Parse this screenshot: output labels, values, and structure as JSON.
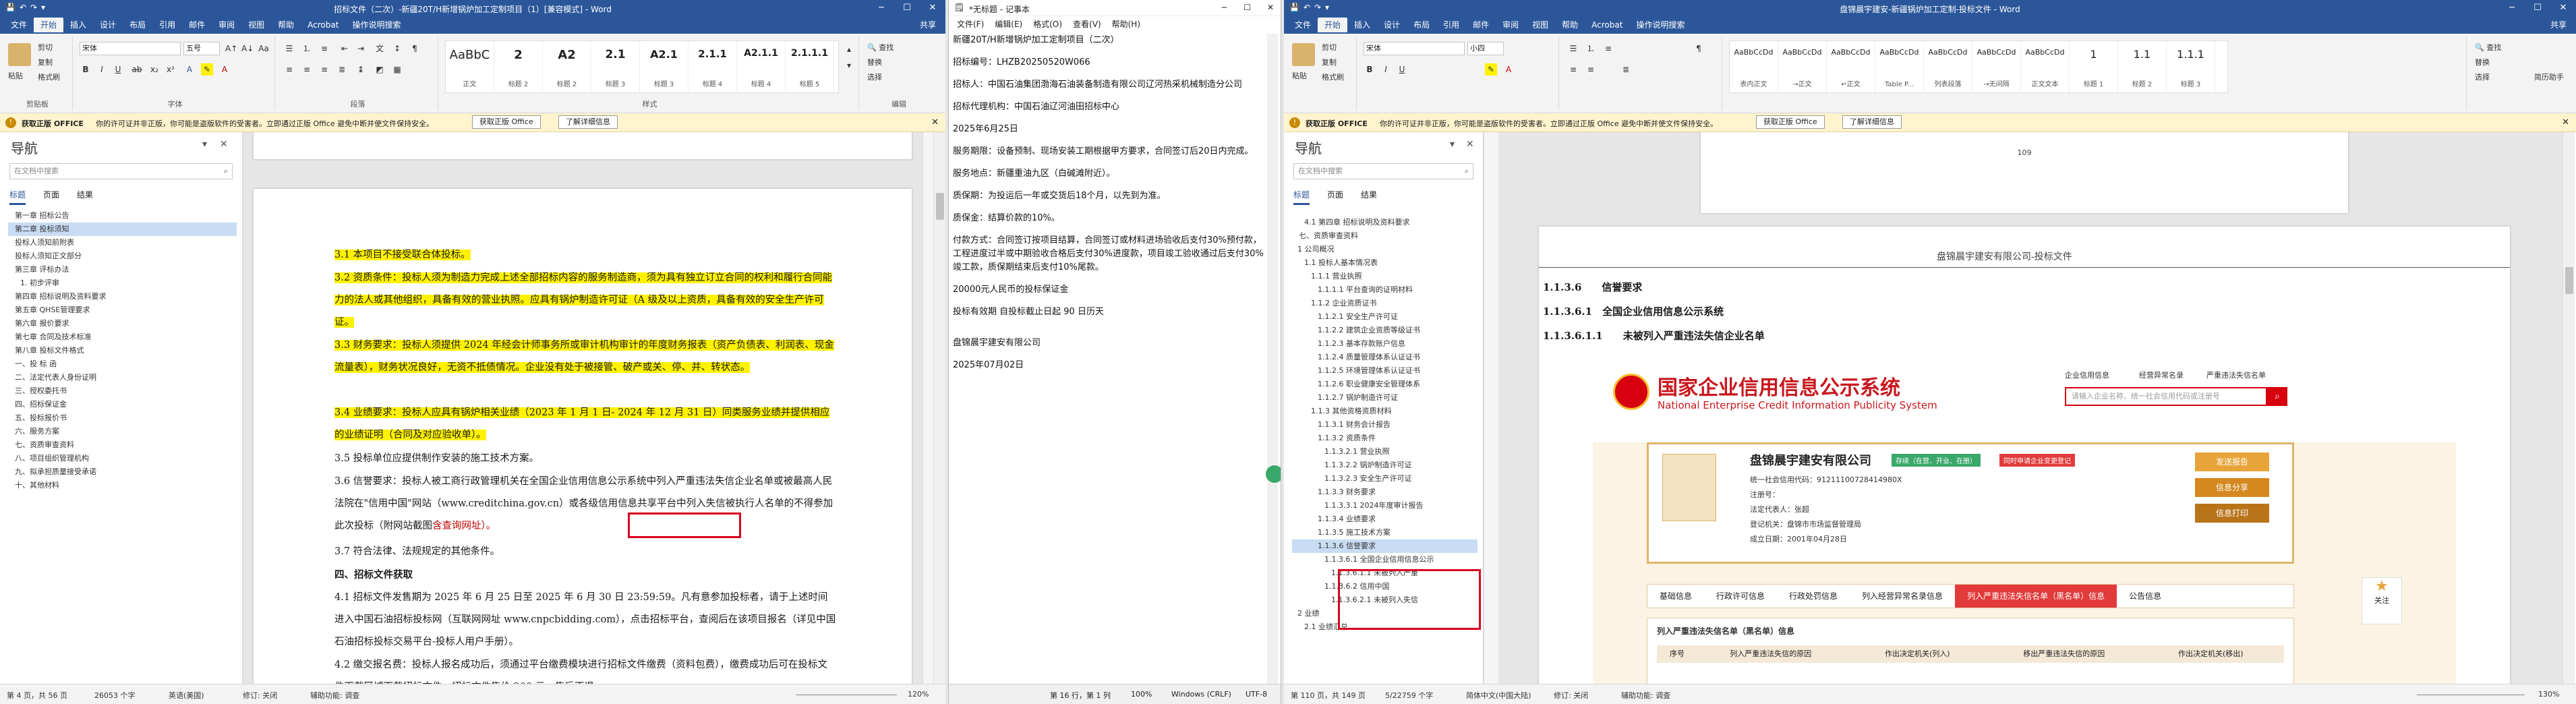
{
  "colors": {
    "word_blue": "#2b579a",
    "highlight": "#fff200",
    "red_box": "#d8001e",
    "gsxt_red": "#c8161d"
  },
  "win1": {
    "title": "招标文件（二次）-新疆20T/H新增锅炉加工定制项目（1）[兼容模式] - Word",
    "qat": [
      "save-icon",
      "undo-icon",
      "redo-icon"
    ],
    "tabs": [
      "文件",
      "开始",
      "插入",
      "设计",
      "布局",
      "引用",
      "邮件",
      "审阅",
      "视图",
      "帮助",
      "Acrobat",
      "操作说明搜索"
    ],
    "share": "共享",
    "clipboard": {
      "paste": "粘贴",
      "cut": "剪切",
      "copy": "复制",
      "format_painter": "格式刷",
      "group": "剪贴板"
    },
    "font": {
      "name": "宋体",
      "size": "五号",
      "group": "字体"
    },
    "paragraph_group": "段落",
    "styles": [
      {
        "preview": "AaBbC",
        "name": "正文"
      },
      {
        "preview": "2",
        "name": "标题 2"
      },
      {
        "preview": "A2",
        "name": "标题 2"
      },
      {
        "preview": "2.1",
        "name": "标题 3"
      },
      {
        "preview": "A2.1",
        "name": "标题 3"
      },
      {
        "preview": "2.1.1",
        "name": "标题 4"
      },
      {
        "preview": "A2.1.1",
        "name": "标题 4"
      },
      {
        "preview": "2.1.1.1",
        "name": "标题 5"
      }
    ],
    "styles_group": "样式",
    "editing": {
      "find": "查找",
      "replace": "替换",
      "select": "选择",
      "group": "编辑"
    },
    "msgbar": {
      "label": "获取正版 OFFICE",
      "text": "你的许可证并非正版，你可能是盗版软件的受害者。立即通过正版 Office 避免中断并使文件保持安全。",
      "btn1": "获取正版 Office",
      "btn2": "了解详细信息"
    },
    "nav": {
      "title": "导航",
      "search_placeholder": "在文档中搜索",
      "tabs": [
        "标题",
        "页面",
        "结果"
      ],
      "items": [
        "第一章  招标公告",
        "第二章  投标须知",
        "投标人须知前附表",
        "投标人须知正文部分",
        "第三章  评标办法",
        "1. 初步评审",
        "第四章  招标说明及资料要求",
        "第五章  QHSE管理要求",
        "第六章  报价要求",
        "第七章  合同及技术标准",
        "第八章  投标文件格式",
        "一、投 标 函",
        "二、法定代表人身份证明",
        "三、授权委托书",
        "四、招标保证金",
        "五、投标报价书",
        "六、服务方案",
        "七、资质审查资料",
        "八、项目组织管理机构",
        "九、拟承担质量接受承诺",
        "十、其他材料"
      ],
      "selected": 1
    },
    "doc_paras": [
      "3.1 本项目不接受联合体投标。",
      "3.2 资质条件：投标人须为制造力完成上述全部招标内容的服务制造商，须为具有独立订立合同的权利和履行合同能力的法人或其他组织，具备有效的营业执照。应具有锅炉制造许可证（A 级及以上资质，具备有效的安全生产许可证。",
      "3.3 财务要求：投标人须提供 2024 年经会计师事务所或审计机构审计的年度财务报表（资产负债表、利润表、现金流量表），财务状况良好，无资不抵债情况。企业没有处于被接管、破产或关、停、并、转状态。",
      "3.4 业绩要求：投标人应具有锅炉相关业绩（2023 年 1 月 1 日- 2024 年 12 月 31 日）同类服务业绩并提供相应的业绩证明（合同及对应验收单）。",
      "3.5 投标单位应提供制作安装的施工技术方案。",
      "3.6 信誉要求：投标人被工商行政管理机关在全国企业信用信息公示系统中列入严重违法失信企业名单或被最高人民法院在\"信用中国\"网站（www.creditchina.gov.cn）或各级信用信息共享平台中列入失信被执行人名单的不得参加此次投标（附网站截图",
      "含查询网址）。",
      "3.7 符合法律、法规规定的其他条件。",
      "四、招标文件获取",
      "4.1 招标文件发售期为 2025 年 6 月 25 日至 2025 年 6 月 30 日 23:59:59。凡有意参加投标者，请于上述时间进入中国石油招标投标网（互联网网址 www.cnpcbidding.com），点击招标平台，查阅后在该项目报名（详见中国石油招标投标交易平台-投标人用户手册）。",
      "4.2 缴交报名费：投标人报名成功后，须通过平台缴费模块进行招标文件缴费（资料包费），缴费成功后可在投标文件下载区域下载招标文件，招标文件售价 200 元，售后不退。"
    ],
    "status": {
      "page": "第 4 页，共 56 页",
      "words": "26053 个字",
      "lang": "英语(美国)",
      "mode": "修订: 关闭",
      "display": "辅助功能: 调查",
      "zoom": "120%"
    }
  },
  "win2": {
    "title": "*无标题 - 记事本",
    "menu": [
      "文件(F)",
      "编辑(E)",
      "格式(O)",
      "查看(V)",
      "帮助(H)"
    ],
    "lines": [
      "新疆20T/H新增锅炉加工定制项目（二次）",
      "招标编号：LHZB20250520W066",
      "招标人：中国石油集团渤海石油装备制造有限公司辽河热采机械制造分公司",
      "招标代理机构：中国石油辽河油田招标中心",
      "2025年6月25日",
      "服务期限：设备预制、现场安装工期根据甲方要求，合同签订后20日内完成。",
      "服务地点：新疆重油九区（白碱滩附近）。",
      "质保期：为投运后一年或交货后18个月，以先到为准。",
      "质保金：结算价款的10%。",
      "付款方式：合同签订按项目结算，合同签订或材料进场验收后支付30%预付款，工程进度过半或中期验收合格后支付30%进度款，项目竣工验收通过后支付30%竣工款，质保期结束后支付10%尾款。",
      "20000元人民币的投标保证金",
      "投标有效期  自投标截止日起 90  日历天",
      "盘锦晨宇建安有限公司",
      "2025年07月02日"
    ],
    "status": {
      "pos": "第 16 行，第 1 列",
      "zoom": "100%",
      "eol": "Windows (CRLF)",
      "enc": "UTF-8"
    }
  },
  "win3": {
    "title": "盘锦晨宇建安-新疆锅炉加工定制-投标文件 - Word",
    "tabs": [
      "文件",
      "开始",
      "插入",
      "设计",
      "布局",
      "引用",
      "邮件",
      "审阅",
      "视图",
      "帮助",
      "Acrobat",
      "操作说明搜索"
    ],
    "share": "共享",
    "font": {
      "name": "宋体",
      "size": "小四"
    },
    "styles": [
      {
        "preview": "AaBbCcDd",
        "name": "表内正文"
      },
      {
        "preview": "AaBbCcDd",
        "name": "→正文"
      },
      {
        "preview": "AaBbCcDd",
        "name": "↵正文"
      },
      {
        "preview": "AaBbCcDd",
        "name": "Table P..."
      },
      {
        "preview": "AaBbCcDd",
        "name": "列表段落"
      },
      {
        "preview": "AaBbCcDd",
        "name": "→无间隔"
      },
      {
        "preview": "AaBbCcDd",
        "name": "正文文本"
      },
      {
        "preview": "1",
        "name": "标题 1"
      },
      {
        "preview": "1.1",
        "name": "标题 2"
      },
      {
        "preview": "1.1.1",
        "name": "标题 3"
      }
    ],
    "extra": {
      "replace": "替换",
      "select": "选择",
      "resume": "简历助手"
    },
    "nav": {
      "title": "导航",
      "search_placeholder": "在文档中搜索",
      "tabs": [
        "标题",
        "页面",
        "结果"
      ],
      "items": [
        "4.1 第四章  招标说明及资料要求",
        "七、资质审查资料",
        "1 公司概况",
        "1.1 投标人基本情况表",
        "1.1.1 营业执照",
        "1.1.1.1 平台查询的证明材料",
        "1.1.2 企业资质证书",
        "1.1.2.1 安全生产许可证",
        "1.1.2.2 建筑企业资质等级证书",
        "1.1.2.3 基本存款账户信息",
        "1.1.2.4 质量管理体系认证证书",
        "1.1.2.5 环境管理体系认证证书",
        "1.1.2.6 职业健康安全管理体系",
        "1.1.2.7 锅炉制造许可证",
        "1.1.3 其他资格资质材料",
        "1.1.3.1 财务会计报告",
        "1.1.3.2 资质条件",
        "1.1.3.2.1 营业执照",
        "1.1.3.2.2 锅炉制造许可证",
        "1.1.3.2.3 安全生产许可证",
        "1.1.3.3 财务要求",
        "1.1.3.3.1 2024年度审计报告",
        "1.1.3.4 业绩要求",
        "1.1.3.5 施工技术方案",
        "1.1.3.6 信誉要求",
        "1.1.3.6.1 全国企业信用信息公示",
        "1.1.3.6.1.1 未被列入严重",
        "1.1.3.6.2 信用中国",
        "1.1.3.6.2.1 未被列入失信",
        "2 业绩",
        "2.1 业绩汇总"
      ],
      "selected": 24
    },
    "page_num": "109",
    "header_text": "盘锦晨宇建安有限公司-投标文件",
    "headings": [
      "1.1.3.6　　信誉要求",
      "1.1.3.6.1　全国企业信用信息公示系统",
      "1.1.3.6.1.1　　未被列入严重违法失信企业名单"
    ],
    "gsxt": {
      "title": "国家企业信用信息公示系统",
      "subtitle": "National Enterprise Credit Information Publicity System",
      "links": [
        "企业信用信息",
        "经营异常名录",
        "严重违法失信名单"
      ],
      "search_placeholder": "请输入企业名称、统一社会信用代码或注册号",
      "company": "盘锦晨宇建安有限公司",
      "tag1": "存续（在营、开业、在册）",
      "tag2": "同时申请企业变更登记",
      "code_label": "统一社会信用代码：",
      "code": "91211100728414980X",
      "reg_label": "注册号：",
      "legal_label": "法定代表人：",
      "legal": "张超",
      "type_label": "登记机关：",
      "type": "盘锦市市场监督管理局",
      "date_label": "成立日期：",
      "date": "2001年04月28日",
      "side_btns": [
        "发送报告",
        "信息分享",
        "信息打印"
      ],
      "tabs": [
        "基础信息",
        "行政许可信息",
        "行政处罚信息",
        "列入经营异常名录信息",
        "列入严重违法失信名单（黑名单）信息",
        "公告信息"
      ],
      "active_tab": 4,
      "list_title": "列入严重违法失信名单（黑名单）信息",
      "cols": [
        "序号",
        "列入严重违法失信的原因",
        "作出决定机关(列入)",
        "移出严重违法失信的原因",
        "作出决定机关(移出)"
      ],
      "follow": "关注"
    },
    "status": {
      "page": "第 110 页，共 149 页",
      "words": "5/22759 个字",
      "lang": "简体中文(中国大陆)",
      "mode": "修订: 关闭",
      "display": "辅助功能: 调查",
      "zoom": "130%"
    }
  }
}
